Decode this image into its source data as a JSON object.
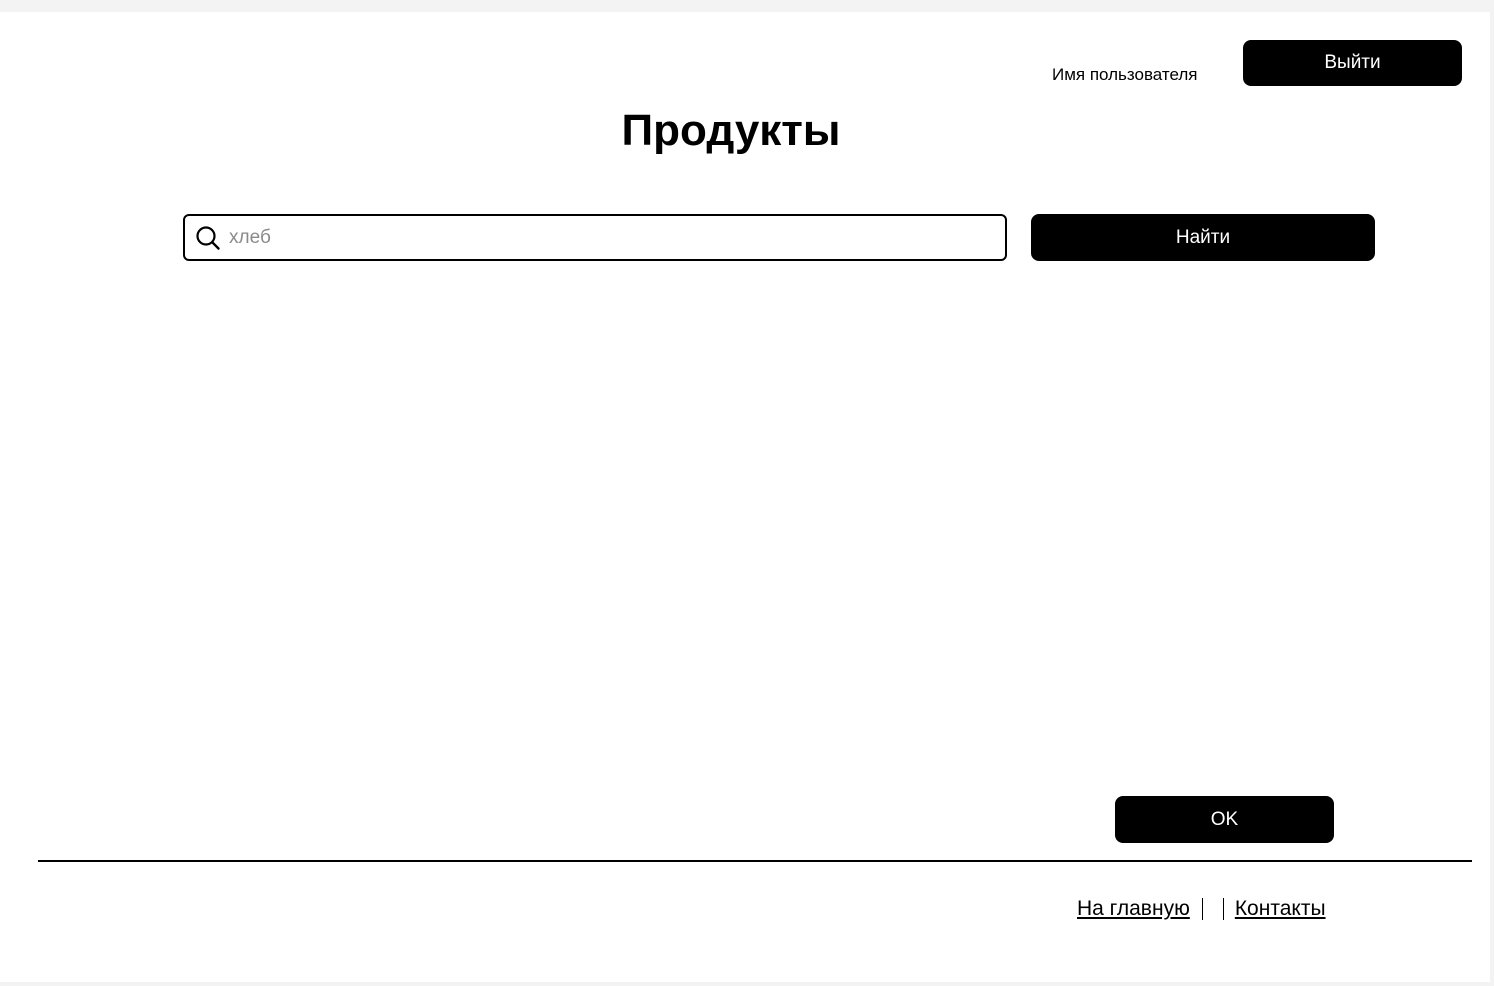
{
  "header": {
    "username": "Имя пользователя",
    "logout_label": "Выйти"
  },
  "page": {
    "title": "Продукты"
  },
  "search": {
    "placeholder": "хлеб",
    "value": "",
    "icon": "search-icon",
    "button_label": "Найти"
  },
  "actions": {
    "ok_label": "OK"
  },
  "footer": {
    "links": [
      {
        "label": "На главную"
      },
      {
        "label": "Контакты"
      }
    ]
  },
  "colors": {
    "primary": "#000000",
    "background": "#ffffff",
    "placeholder": "#8a8a8a"
  }
}
